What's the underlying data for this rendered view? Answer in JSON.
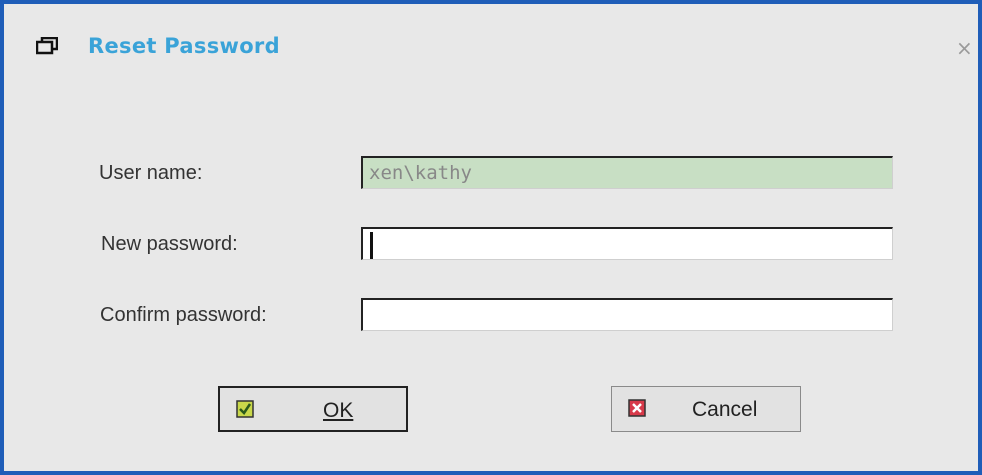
{
  "window": {
    "title": "Reset Password",
    "icon": "windows-icon",
    "close_glyph": "×"
  },
  "form": {
    "username_label": "User name:",
    "username_value": "xen\\kathy",
    "new_password_label": "New password:",
    "new_password_value": "",
    "confirm_password_label": "Confirm password:",
    "confirm_password_value": ""
  },
  "buttons": {
    "ok_label": "OK",
    "cancel_label": "Cancel"
  },
  "colors": {
    "title": "#3aa3d8",
    "frame": "#1f5db8",
    "readonly_field": "#c8dfc4"
  }
}
